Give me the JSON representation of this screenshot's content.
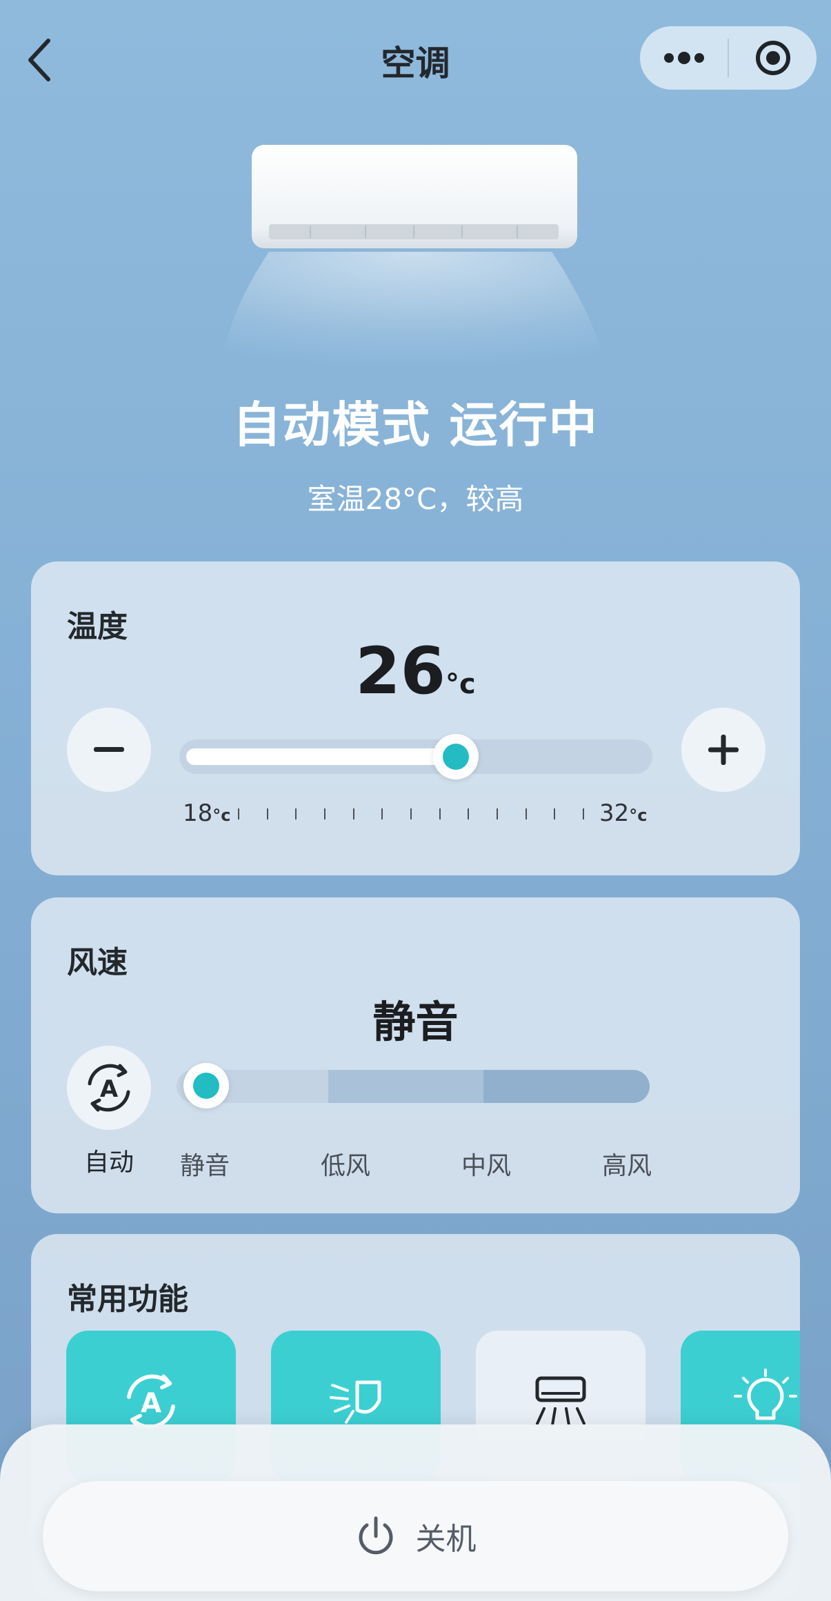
{
  "header": {
    "title": "空调",
    "menu_icon": "more-dots-icon",
    "close_icon": "target-circle-icon"
  },
  "hero": {
    "status": "自动模式 运行中",
    "room_temp_text": "室温28°C，较高"
  },
  "temperature": {
    "section_title": "温度",
    "value": "26",
    "unit": "°c",
    "min_label": "18",
    "max_label": "32",
    "scale_unit": "°c",
    "min": 18,
    "max": 32,
    "current": 26
  },
  "fan": {
    "section_title": "风速",
    "value": "静音",
    "auto_label": "自动",
    "levels": [
      "静音",
      "低风",
      "中风",
      "高风"
    ],
    "current_level": 0
  },
  "functions": {
    "section_title": "常用功能",
    "items": [
      {
        "icon": "auto-mode-icon",
        "active": true
      },
      {
        "icon": "swing-icon",
        "active": true
      },
      {
        "icon": "airflow-icon",
        "active": false
      },
      {
        "icon": "light-icon",
        "active": true
      }
    ]
  },
  "power": {
    "label": "关机"
  },
  "colors": {
    "accent": "#22bcc2",
    "tile_active": "#3ccfd2",
    "tile_inactive": "#e9eff6"
  }
}
